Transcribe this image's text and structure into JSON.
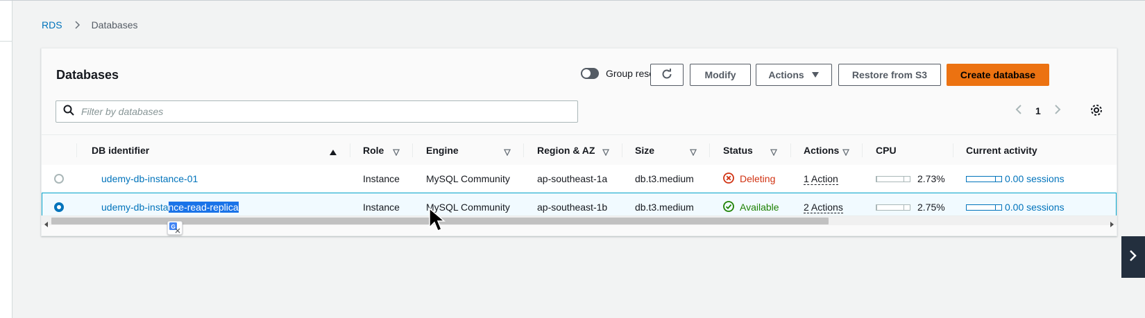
{
  "breadcrumb": {
    "root": "RDS",
    "current": "Databases"
  },
  "panel": {
    "title": "Databases",
    "group_resources_label": "Group resources",
    "buttons": {
      "modify": "Modify",
      "actions": "Actions",
      "restore": "Restore from S3",
      "create": "Create database"
    },
    "filter_placeholder": "Filter by databases",
    "page_number": "1"
  },
  "table": {
    "columns": [
      "DB identifier",
      "Role",
      "Engine",
      "Region & AZ",
      "Size",
      "Status",
      "Actions",
      "CPU",
      "Current activity"
    ],
    "rows": [
      {
        "selected": false,
        "identifier": "udemy-db-instance-01",
        "identifier_plain": "udemy-db-instance-01",
        "identifier_highlighted": "",
        "role": "Instance",
        "engine": "MySQL Community",
        "region": "ap-southeast-1a",
        "size": "db.t3.medium",
        "status": "Deleting",
        "actions": "1 Action",
        "cpu": "2.73%",
        "cpu_fraction": 0.0273,
        "activity": "0.00 sessions"
      },
      {
        "selected": true,
        "identifier": "udemy-db-instance-read-replica",
        "identifier_plain": "udemy-db-insta",
        "identifier_highlighted": "nce-read-replica",
        "role": "Instance",
        "engine": "MySQL Community",
        "region": "ap-southeast-1b",
        "size": "db.t3.medium",
        "status": "Available",
        "actions": "2 Actions",
        "cpu": "2.75%",
        "cpu_fraction": 0.0275,
        "activity": "0.00 sessions"
      }
    ]
  },
  "colors": {
    "primary_button": "#ec7211",
    "link": "#0073bb",
    "deleting": "#d13212",
    "available": "#1d8102",
    "selected_row": "#f1faff"
  },
  "icons": [
    "chevron-right-icon",
    "refresh-icon",
    "caret-down-icon",
    "search-icon",
    "chevron-left-icon",
    "gear-icon",
    "sort-ascending-icon",
    "sort-descending-icon",
    "error-circle-icon",
    "check-circle-icon",
    "translate-icon",
    "mouse-pointer-icon"
  ]
}
